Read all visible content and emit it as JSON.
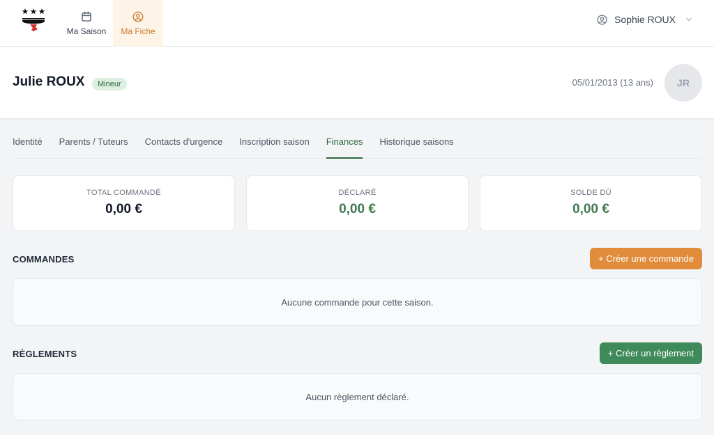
{
  "nav": {
    "items": [
      {
        "label": "Ma Saison",
        "icon": "calendar-icon"
      },
      {
        "label": "Ma Fiche",
        "icon": "user-circle-icon",
        "active": true
      }
    ],
    "user": {
      "name": "Sophie ROUX",
      "icon": "user-circle-icon"
    }
  },
  "header": {
    "name": "Julie ROUX",
    "badge": "Mineur",
    "dob": "05/01/2013 (13 ans)",
    "initials": "JR"
  },
  "tabs": [
    {
      "label": "Identité"
    },
    {
      "label": "Parents / Tuteurs"
    },
    {
      "label": "Contacts d'urgence"
    },
    {
      "label": "Inscription saison"
    },
    {
      "label": "Finances",
      "active": true
    },
    {
      "label": "Historique saisons"
    }
  ],
  "stats": [
    {
      "label": "TOTAL COMMANDÉ",
      "value": "0,00 €"
    },
    {
      "label": "DÉCLARÉ",
      "value": "0,00 €"
    },
    {
      "label": "SOLDE DÛ",
      "value": "0,00 €"
    }
  ],
  "commandes": {
    "title": "COMMANDES",
    "button": "+ Créer une commande",
    "empty": "Aucune commande pour cette saison."
  },
  "reglements": {
    "title": "RÈGLEMENTS",
    "button": "+ Créer un règlement",
    "empty": "Aucun règlement déclaré."
  },
  "colors": {
    "accent_orange": "#e08c3a",
    "accent_green": "#3f8a5a",
    "badge_bg": "#dcefe0"
  }
}
